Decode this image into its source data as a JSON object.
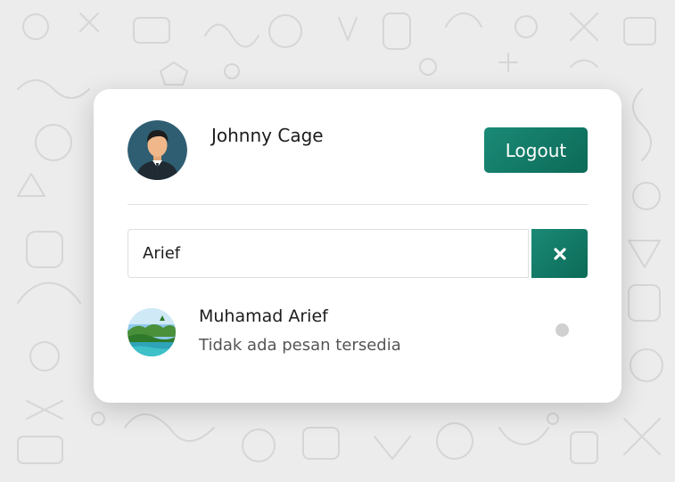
{
  "user": {
    "name": "Johnny Cage",
    "avatar_icon": "user-avatar-icon"
  },
  "header": {
    "logout_label": "Logout"
  },
  "search": {
    "value": "Arief",
    "clear_icon": "close-icon"
  },
  "contacts": [
    {
      "name": "Muhamad Arief",
      "last_message": "Tidak ada pesan tersedia",
      "status": "offline",
      "avatar_icon": "landscape-avatar-icon"
    }
  ],
  "colors": {
    "accent": "#0f7462",
    "background": "#ececec",
    "card": "#ffffff",
    "status_offline": "#d0d0d0"
  }
}
